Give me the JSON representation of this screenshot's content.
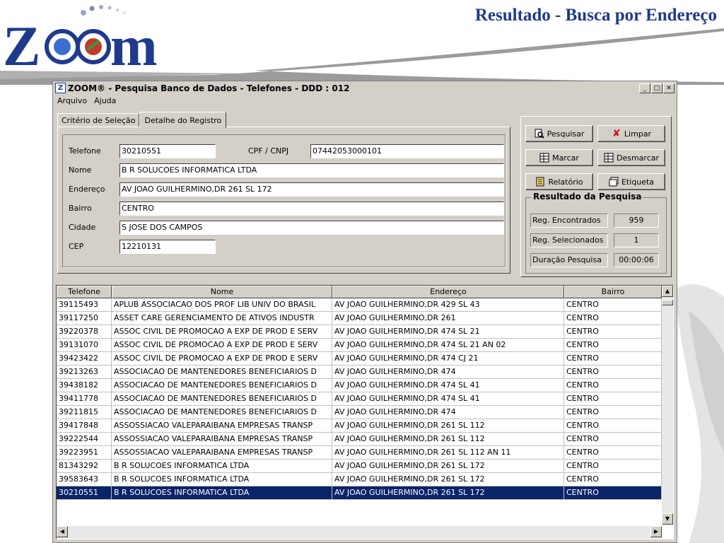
{
  "slide": {
    "title": "Resultado - Busca por Endereço",
    "logo_text": "Zoom"
  },
  "window": {
    "title": "ZOOM® - Pesquisa Banco de Dados - Telefones - DDD : 012",
    "menu": [
      "Arquivo",
      "Ajuda"
    ],
    "tabs": [
      "Critério de Seleção",
      "Detalhe do Registro"
    ]
  },
  "detail": {
    "labels": {
      "telefone": "Telefone",
      "cpf": "CPF / CNPJ",
      "nome": "Nome",
      "endereco": "Endereço",
      "bairro": "Bairro",
      "cidade": "Cidade",
      "cep": "CEP"
    },
    "values": {
      "telefone": "30210551",
      "cpf": "07442053000101",
      "nome": "B R SOLUCOES INFORMATICA LTDA",
      "endereco": "AV JOAO GUILHERMINO,DR 261 SL 172",
      "bairro": "CENTRO",
      "cidade": "S JOSE DOS CAMPOS",
      "cep": "12210131"
    }
  },
  "buttons": {
    "pesquisar": "Pesquisar",
    "limpar": "Limpar",
    "marcar": "Marcar",
    "desmarcar": "Desmarcar",
    "relatorio": "Relatório",
    "etiqueta": "Etiqueta"
  },
  "result": {
    "title": "Resultado da Pesquisa",
    "encontrados_label": "Reg. Encontrados",
    "encontrados_value": "959",
    "selecionados_label": "Reg. Selecionados",
    "selecionados_value": "1",
    "duracao_label": "Duração Pesquisa",
    "duracao_value": "00:00:06"
  },
  "grid": {
    "headers": [
      "Telefone",
      "Nome",
      "Endereço",
      "Bairro"
    ],
    "rows": [
      [
        "39115493",
        "APLUB ASSOCIACAO DOS PROF LIB UNIV DO BRASIL",
        "AV JOAO GUILHERMINO,DR 429 SL 43",
        "CENTRO"
      ],
      [
        "39117250",
        "ASSET CARE GERENCIAMENTO DE ATIVOS INDUSTR",
        "AV JOAO GUILHERMINO,DR 261",
        "CENTRO"
      ],
      [
        "39220378",
        "ASSOC CIVIL DE PROMOCAO A EXP DE PROD E SERV",
        "AV JOAO GUILHERMINO,DR 474 SL 21",
        "CENTRO"
      ],
      [
        "39131070",
        "ASSOC CIVIL DE PROMOCAO A EXP DE PROD E SERV",
        "AV JOAO GUILHERMINO,DR 474 SL 21 AN 02",
        "CENTRO"
      ],
      [
        "39423422",
        "ASSOC CIVIL DE PROMOCAO A EXP DE PROD E SERV",
        "AV JOAO GUILHERMINO,DR 474 CJ 21",
        "CENTRO"
      ],
      [
        "39213263",
        "ASSOCIACAO DE MANTENEDORES BENEFICIARIOS D",
        "AV JOAO GUILHERMINO,DR 474",
        "CENTRO"
      ],
      [
        "39438182",
        "ASSOCIACAO DE MANTENEDORES BENEFICIARIOS D",
        "AV JOAO GUILHERMINO,DR 474 SL 41",
        "CENTRO"
      ],
      [
        "39411778",
        "ASSOCIACAO DE MANTENEDORES BENEFICIARIOS D",
        "AV JOAO GUILHERMINO,DR 474 SL 41",
        "CENTRO"
      ],
      [
        "39211815",
        "ASSOCIACAO DE MANTENEDORES BENEFICIARIOS D",
        "AV JOAO GUILHERMINO,DR 474",
        "CENTRO"
      ],
      [
        "39417848",
        "ASSOSSIACAO VALEPARAIBANA EMPRESAS TRANSP",
        "AV JOAO GUILHERMINO,DR 261 SL 112",
        "CENTRO"
      ],
      [
        "39222544",
        "ASSOSSIACAO VALEPARAIBANA EMPRESAS TRANSP",
        "AV JOAO GUILHERMINO,DR 261 SL 112",
        "CENTRO"
      ],
      [
        "39223951",
        "ASSOSSIACAO VALEPARAIBANA EMPRESAS TRANSP",
        "AV JOAO GUILHERMINO,DR 261 SL 112 AN 11",
        "CENTRO"
      ],
      [
        "81343292",
        "B R SOLUCOES INFORMATICA LTDA",
        "AV JOAO GUILHERMINO,DR 261 SL 172",
        "CENTRO"
      ],
      [
        "39583643",
        "B R SOLUCOES INFORMATICA LTDA",
        "AV JOAO GUILHERMINO,DR 261 SL 172",
        "CENTRO"
      ],
      [
        "30210551",
        "B R SOLUCOES INFORMATICA LTDA",
        "AV JOAO GUILHERMINO,DR 261 SL 172",
        "CENTRO"
      ]
    ],
    "selected_index": 14
  },
  "colors": {
    "title_blue": "#1f3a8c",
    "selection": "#0a246a",
    "window_face": "#d4d0c8"
  }
}
